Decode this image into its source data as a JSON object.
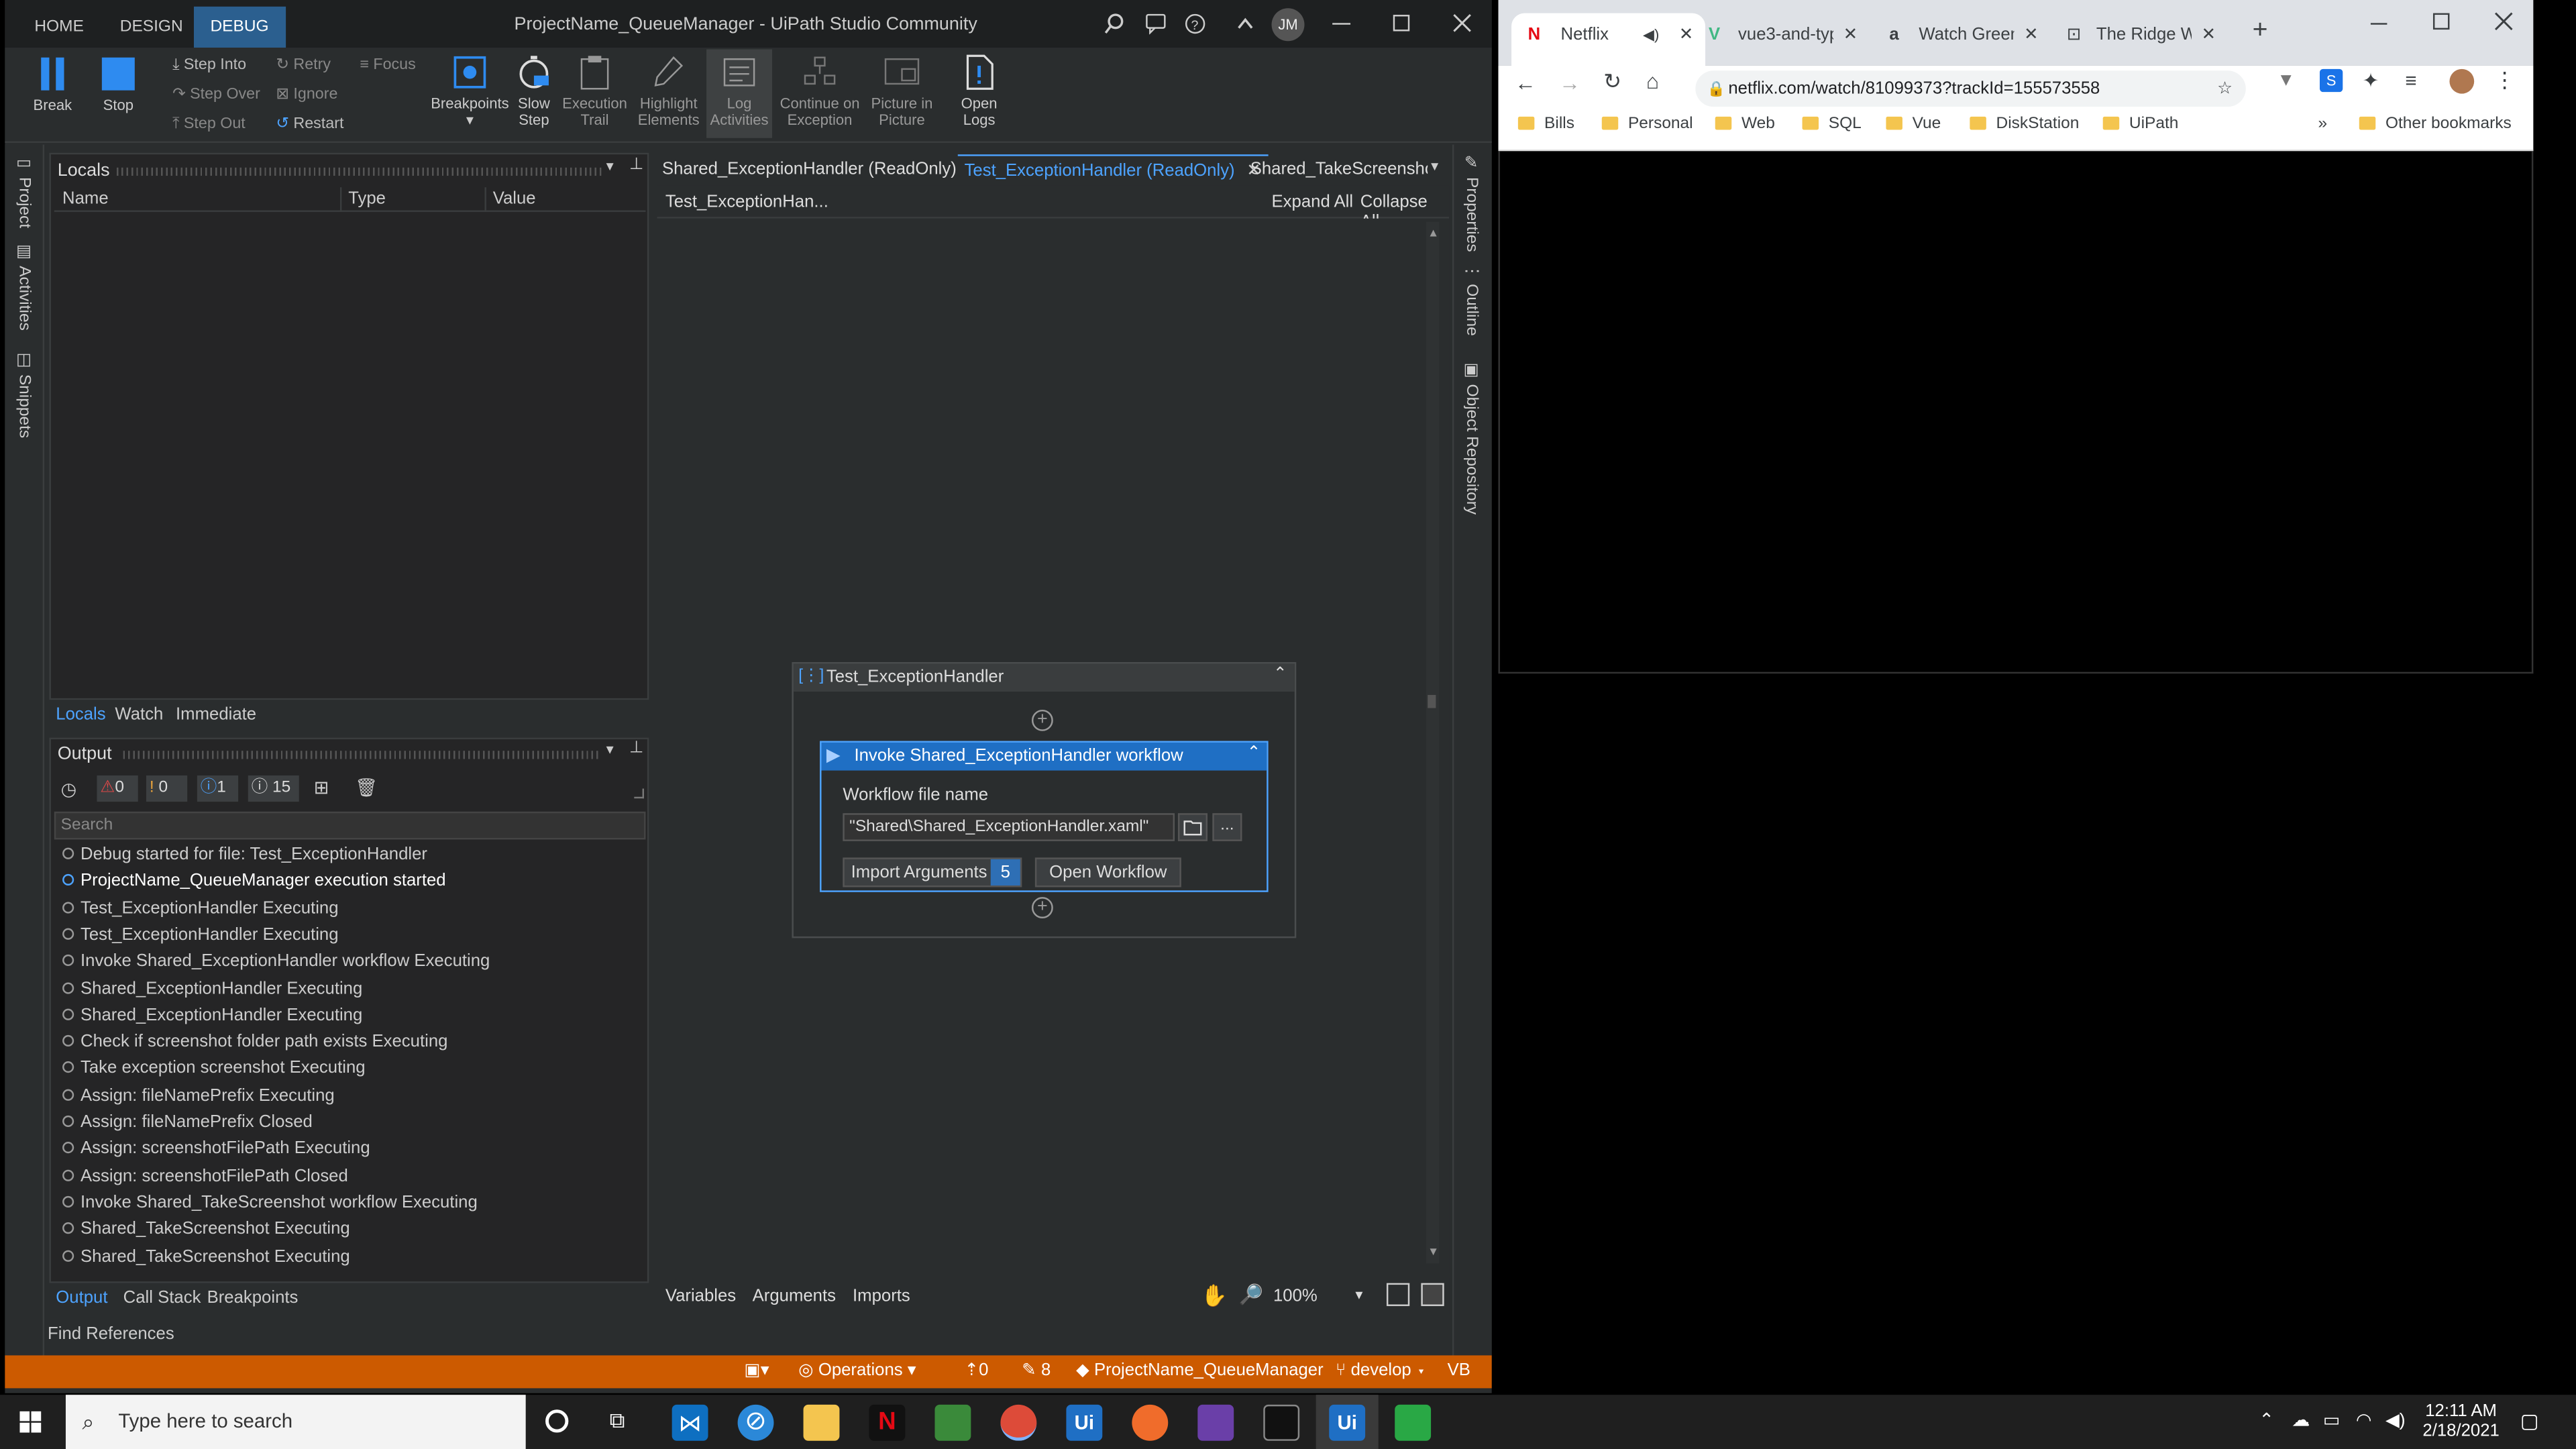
{
  "studio": {
    "window_title": "ProjectName_QueueManager - UiPath Studio Community",
    "user_initials": "JM",
    "ribbon_tabs": [
      "HOME",
      "DESIGN",
      "DEBUG"
    ],
    "ribbon": {
      "break": "Break",
      "stop": "Stop",
      "step_into": "Step Into",
      "step_over": "Step Over",
      "step_out": "Step Out",
      "retry": "Retry",
      "ignore": "Ignore",
      "restart": "Restart",
      "focus": "Focus",
      "breakpoints": "Breakpoints",
      "slow_step": [
        "Slow",
        "Step"
      ],
      "execution_trail": [
        "Execution",
        "Trail"
      ],
      "highlight_elements": [
        "Highlight",
        "Elements"
      ],
      "log_activities": [
        "Log",
        "Activities"
      ],
      "continue_on_exception": [
        "Continue on",
        "Exception"
      ],
      "picture_in_picture": [
        "Picture in",
        "Picture"
      ],
      "open_logs": [
        "Open",
        "Logs"
      ]
    },
    "left_sidebar": [
      "Project",
      "Activities",
      "Snippets"
    ],
    "right_sidebar": [
      "Properties",
      "Outline",
      "Object Repository"
    ],
    "locals": {
      "title": "Locals",
      "columns": [
        "Name",
        "Type",
        "Value"
      ],
      "tabs": [
        "Locals",
        "Watch",
        "Immediate"
      ]
    },
    "output": {
      "title": "Output",
      "counts": {
        "errors": "0",
        "warnings": "0",
        "info": "1",
        "trace": "15"
      },
      "search_placeholder": "Search",
      "rows": [
        "Debug started for file: Test_ExceptionHandler",
        "ProjectName_QueueManager execution started",
        "Test_ExceptionHandler Executing",
        "Test_ExceptionHandler Executing",
        "Invoke Shared_ExceptionHandler workflow Executing",
        "Shared_ExceptionHandler Executing",
        "Shared_ExceptionHandler Executing",
        "Check if screenshot folder path exists Executing",
        "Take exception screenshot Executing",
        "Assign: fileNamePrefix Executing",
        "Assign: fileNamePrefix Closed",
        "Assign: screenshotFilePath Executing",
        "Assign: screenshotFilePath Closed",
        "Invoke Shared_TakeScreenshot workflow Executing",
        "Shared_TakeScreenshot Executing",
        "Shared_TakeScreenshot Executing"
      ],
      "tabs": [
        "Output",
        "Call Stack",
        "Breakpoints"
      ]
    },
    "find_references": "Find References",
    "doc_tabs": [
      "Shared_ExceptionHandler (ReadOnly)",
      "Test_ExceptionHandler (ReadOnly)",
      "Shared_TakeScreenshot ("
    ],
    "breadcrumb": "Test_ExceptionHan...",
    "expand_all": "Expand All",
    "collapse_all": "Collapse All",
    "sequence": {
      "title": "Test_ExceptionHandler",
      "activity_title": "Invoke Shared_ExceptionHandler workflow",
      "field_label": "Workflow file name",
      "field_value": "\"Shared\\Shared_ExceptionHandler.xaml\"",
      "import_arguments": "Import Arguments",
      "argument_count": "5",
      "open_workflow": "Open Workflow"
    },
    "designer_bottom_tabs": [
      "Variables",
      "Arguments",
      "Imports"
    ],
    "zoom": "100%",
    "statusbar": {
      "operations": "Operations",
      "up_count": "0",
      "edit_count": "8",
      "project": "ProjectName_QueueManager",
      "branch": "develop",
      "language": "VB"
    }
  },
  "chrome": {
    "tabs": [
      "Netflix",
      "vue3-and-typ",
      "Watch Green",
      "The Ridge W"
    ],
    "url": "netflix.com/watch/81099373?trackId=155573558",
    "bookmarks": [
      "Bills",
      "Personal",
      "Web",
      "SQL",
      "Vue",
      "DiskStation",
      "UiPath"
    ],
    "other_bookmarks": "Other bookmarks"
  },
  "taskbar": {
    "search_placeholder": "Type here to search",
    "time": "12:11 AM",
    "date": "2/18/2021"
  }
}
